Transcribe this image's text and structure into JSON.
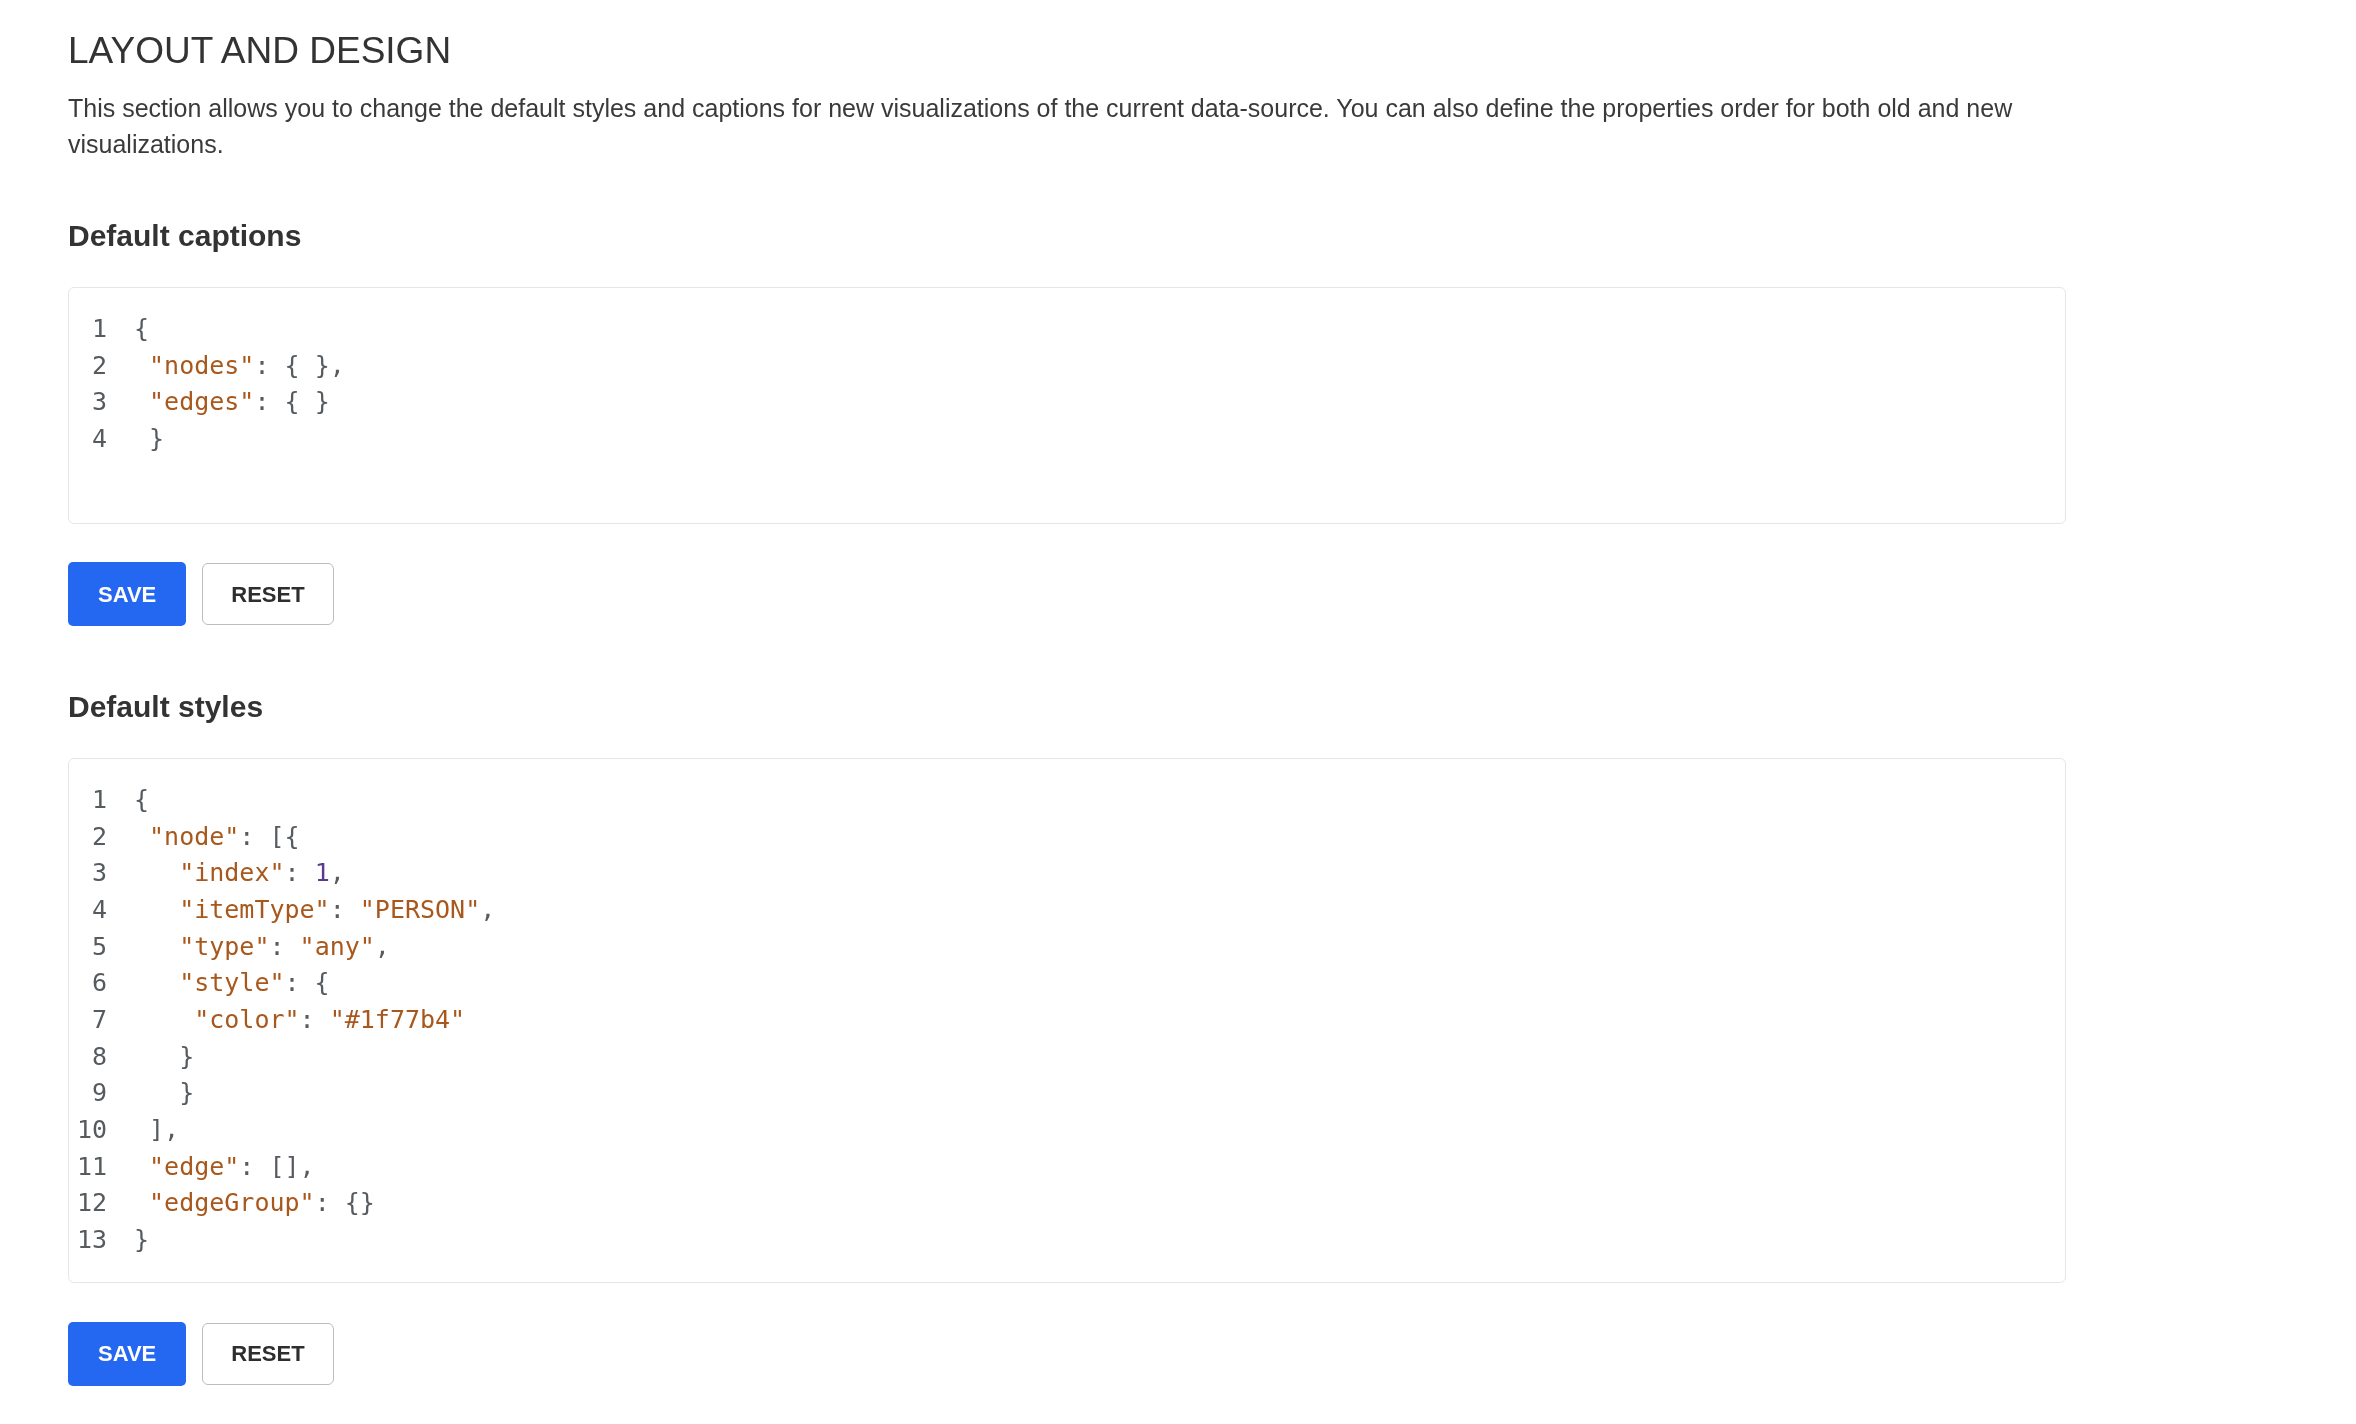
{
  "page": {
    "title": "LAYOUT AND DESIGN",
    "description": "This section allows you to change the default styles and captions for new visualizations of the current data-source. You can also define the properties order for both old and new visualizations."
  },
  "sections": [
    {
      "heading": "Default captions",
      "editor": {
        "lines": [
          {
            "number": "1",
            "tokens": [
              {
                "kind": "punct",
                "text": "{"
              }
            ]
          },
          {
            "number": "2",
            "tokens": [
              {
                "kind": "key",
                "text": " \"nodes\""
              },
              {
                "kind": "punct",
                "text": ": { },"
              }
            ]
          },
          {
            "number": "3",
            "tokens": [
              {
                "kind": "key",
                "text": " \"edges\""
              },
              {
                "kind": "punct",
                "text": ": { }"
              }
            ]
          },
          {
            "number": "4",
            "tokens": [
              {
                "kind": "punct",
                "text": " }"
              }
            ]
          }
        ]
      },
      "buttons": [
        {
          "label": "SAVE",
          "kind": "primary"
        },
        {
          "label": "RESET",
          "kind": "secondary"
        }
      ]
    },
    {
      "heading": "Default styles",
      "editor": {
        "lines": [
          {
            "number": "1",
            "tokens": [
              {
                "kind": "punct",
                "text": "{"
              }
            ]
          },
          {
            "number": "2",
            "tokens": [
              {
                "kind": "key",
                "text": " \"node\""
              },
              {
                "kind": "punct",
                "text": ": [{"
              }
            ]
          },
          {
            "number": "3",
            "tokens": [
              {
                "kind": "key",
                "text": "   \"index\""
              },
              {
                "kind": "punct",
                "text": ": "
              },
              {
                "kind": "number",
                "text": "1"
              },
              {
                "kind": "punct",
                "text": ","
              }
            ]
          },
          {
            "number": "4",
            "tokens": [
              {
                "kind": "key",
                "text": "   \"itemType\""
              },
              {
                "kind": "punct",
                "text": ": "
              },
              {
                "kind": "string",
                "text": "\"PERSON\""
              },
              {
                "kind": "punct",
                "text": ","
              }
            ]
          },
          {
            "number": "5",
            "tokens": [
              {
                "kind": "key",
                "text": "   \"type\""
              },
              {
                "kind": "punct",
                "text": ": "
              },
              {
                "kind": "string",
                "text": "\"any\""
              },
              {
                "kind": "punct",
                "text": ","
              }
            ]
          },
          {
            "number": "6",
            "tokens": [
              {
                "kind": "key",
                "text": "   \"style\""
              },
              {
                "kind": "punct",
                "text": ": {"
              }
            ]
          },
          {
            "number": "7",
            "tokens": [
              {
                "kind": "key",
                "text": "    \"color\""
              },
              {
                "kind": "punct",
                "text": ": "
              },
              {
                "kind": "string",
                "text": "\"#1f77b4\""
              }
            ]
          },
          {
            "number": "8",
            "tokens": [
              {
                "kind": "punct",
                "text": "   }"
              }
            ]
          },
          {
            "number": "9",
            "tokens": [
              {
                "kind": "punct",
                "text": "   }"
              }
            ]
          },
          {
            "number": "10",
            "tokens": [
              {
                "kind": "punct",
                "text": " ],"
              }
            ]
          },
          {
            "number": "11",
            "tokens": [
              {
                "kind": "key",
                "text": " \"edge\""
              },
              {
                "kind": "punct",
                "text": ": [],"
              }
            ]
          },
          {
            "number": "12",
            "tokens": [
              {
                "kind": "key",
                "text": " \"edgeGroup\""
              },
              {
                "kind": "punct",
                "text": ": {}"
              }
            ]
          },
          {
            "number": "13",
            "tokens": [
              {
                "kind": "punct",
                "text": "}"
              }
            ]
          }
        ]
      },
      "buttons": [
        {
          "label": "SAVE",
          "kind": "primary"
        },
        {
          "label": "RESET",
          "kind": "secondary"
        }
      ]
    }
  ]
}
